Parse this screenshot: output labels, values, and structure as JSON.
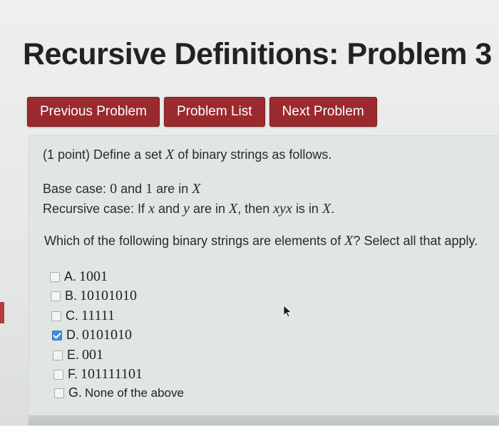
{
  "page": {
    "title": "Recursive Definitions: Problem 3"
  },
  "nav": {
    "previous": "Previous Problem",
    "list": "Problem List",
    "next": "Next Problem"
  },
  "problem": {
    "intro_prefix": "(1 point) Define a set",
    "intro_var": "X",
    "intro_suffix": "of binary strings as follows.",
    "base_prefix": "Base case:",
    "base_zero": "0",
    "base_and": "and",
    "base_one": "1",
    "base_are_in": "are in",
    "base_var": "X",
    "rec_prefix": "Recursive case: If",
    "rec_x": "x",
    "rec_and": "and",
    "rec_y": "y",
    "rec_are_in": "are in",
    "rec_var": "X",
    "rec_then": ", then",
    "rec_xyx": "xyx",
    "rec_is_in": "is in",
    "rec_var2": "X",
    "rec_end": ".",
    "question_prefix": "Which of the following binary strings are elements of",
    "question_var": "X",
    "question_suffix": "? Select all that apply."
  },
  "choices": [
    {
      "letter": "A.",
      "value": "1001",
      "checked": false
    },
    {
      "letter": "B.",
      "value": "10101010",
      "checked": false
    },
    {
      "letter": "C.",
      "value": "11111",
      "checked": false
    },
    {
      "letter": "D.",
      "value": "0101010",
      "checked": true
    },
    {
      "letter": "E.",
      "value": "001",
      "checked": false
    },
    {
      "letter": "F.",
      "value": "101111101",
      "checked": false
    },
    {
      "letter": "G.",
      "value": "None of the above",
      "checked": false
    }
  ],
  "colors": {
    "button": "#9b2a2f",
    "checked": "#3d8fe0"
  }
}
